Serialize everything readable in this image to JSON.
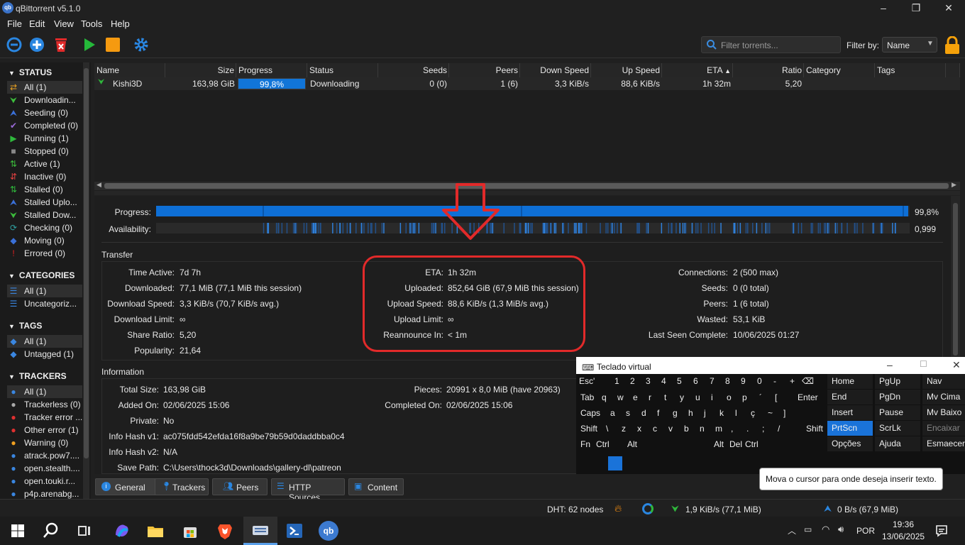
{
  "window": {
    "title": "qBittorrent v5.1.0"
  },
  "menu": [
    "File",
    "Edit",
    "View",
    "Tools",
    "Help"
  ],
  "toolbar": {
    "filter_placeholder": "Filter torrents...",
    "filter_by_label": "Filter by:",
    "filter_by_value": "Name",
    "icons": [
      "link-icon",
      "add-icon",
      "delete-icon",
      "start-icon",
      "stop-icon",
      "options-gear-icon"
    ]
  },
  "sidebar": {
    "status_header": "STATUS",
    "status": [
      "All (1)",
      "Downloadin...",
      "Seeding (0)",
      "Completed (0)",
      "Running (1)",
      "Stopped (0)",
      "Active (1)",
      "Inactive (0)",
      "Stalled (0)",
      "Stalled Uplo...",
      "Stalled Dow...",
      "Checking (0)",
      "Moving (0)",
      "Errored (0)"
    ],
    "categories_header": "CATEGORIES",
    "categories": [
      "All (1)",
      "Uncategoriz..."
    ],
    "tags_header": "TAGS",
    "tags": [
      "All (1)",
      "Untagged (1)"
    ],
    "trackers_header": "TRACKERS",
    "trackers": [
      "All (1)",
      "Trackerless (0)",
      "Tracker error ...",
      "Other error (1)",
      "Warning (0)",
      "atrack.pow7....",
      "open.stealth....",
      "open.touki.r...",
      "p4p.arenabg..."
    ],
    "colors": {
      "status_icons": [
        "#e8a020",
        "#3cbc3c",
        "#3a70d8",
        "#9a6ad8",
        "#2fb83c",
        "#888888",
        "#3cbc3c",
        "#e04040",
        "#2fb83c",
        "#3a70d8",
        "#3cbc3c",
        "#2fa0a0",
        "#3a70d8",
        "#e02020"
      ]
    }
  },
  "torrent_list": {
    "headers": [
      "Name",
      "Size",
      "Progress",
      "Status",
      "Seeds",
      "Peers",
      "Down Speed",
      "Up Speed",
      "ETA",
      "Ratio",
      "Category",
      "Tags"
    ],
    "rows": [
      {
        "name": "Kishi3D",
        "size": "163,98 GiB",
        "progress_text": "99,8%",
        "progress": 0.998,
        "status": "Downloading",
        "seeds": "0 (0)",
        "peers": "1 (6)",
        "down": "3,3 KiB/s",
        "up": "88,6 KiB/s",
        "eta": "1h 32m",
        "ratio": "5,20",
        "category": "",
        "tags": ""
      }
    ]
  },
  "general": {
    "progress_label": "Progress:",
    "progress_value": "99,8%",
    "availability_label": "Availability:",
    "availability_value": "0,999",
    "transfer_header": "Transfer",
    "transfer_col1": [
      [
        "Time Active:",
        "7d 7h"
      ],
      [
        "Downloaded:",
        "77,1 MiB (77,1 MiB this session)"
      ],
      [
        "Download Speed:",
        "3,3 KiB/s (70,7 KiB/s avg.)"
      ],
      [
        "Download Limit:",
        "∞"
      ],
      [
        "Share Ratio:",
        "5,20"
      ],
      [
        "Popularity:",
        "21,64"
      ]
    ],
    "transfer_col2": [
      [
        "ETA:",
        "1h 32m"
      ],
      [
        "Uploaded:",
        "852,64 GiB (67,9 MiB this session)"
      ],
      [
        "Upload Speed:",
        "88,6 KiB/s (1,3 MiB/s avg.)"
      ],
      [
        "Upload Limit:",
        "∞"
      ],
      [
        "Reannounce In:",
        "< 1m"
      ]
    ],
    "transfer_col3": [
      [
        "Connections:",
        "2 (500 max)"
      ],
      [
        "Seeds:",
        "0 (0 total)"
      ],
      [
        "Peers:",
        "1 (6 total)"
      ],
      [
        "Wasted:",
        "53,1 KiB"
      ],
      [
        "Last Seen Complete:",
        "10/06/2025 01:27"
      ]
    ],
    "information_header": "Information",
    "info_col1": [
      [
        "Total Size:",
        "163,98 GiB"
      ],
      [
        "Added On:",
        "02/06/2025 15:06"
      ],
      [
        "Private:",
        "No"
      ],
      [
        "Info Hash v1:",
        "ac075fdd542efda16f8a9be79b59d0daddbba0c4"
      ],
      [
        "Info Hash v2:",
        "N/A"
      ],
      [
        "Save Path:",
        "C:\\Users\\thock3d\\Downloads\\gallery-dl\\patreon"
      ]
    ],
    "info_col2": [
      [
        "Pieces:",
        "20991 x 8,0 MiB (have 20963)"
      ],
      [
        "Completed On:",
        "02/06/2025 15:06"
      ]
    ]
  },
  "bottom_tabs": [
    "General",
    "Trackers",
    "Peers",
    "HTTP Sources",
    "Content"
  ],
  "virtual_keyboard": {
    "title": "Teclado virtual",
    "row1": [
      "Esc",
      "'",
      "1",
      "2",
      "3",
      "4",
      "5",
      "6",
      "7",
      "8",
      "9",
      "0",
      "-",
      "+",
      "⌫"
    ],
    "row2": [
      "Tab",
      "q",
      "w",
      "e",
      "r",
      "t",
      "y",
      "u",
      "i",
      "o",
      "p",
      "´",
      "[",
      "Enter"
    ],
    "row3": [
      "Caps",
      "a",
      "s",
      "d",
      "f",
      "g",
      "h",
      "j",
      "k",
      "l",
      "ç",
      "~",
      "]"
    ],
    "row4": [
      "Shift",
      "\\",
      "z",
      "x",
      "c",
      "v",
      "b",
      "n",
      "m",
      ",",
      ".",
      ";",
      "/",
      "Shift"
    ],
    "row5": [
      "Fn",
      "Ctrl",
      "Alt",
      "Alt",
      "Del",
      "Ctrl"
    ],
    "nav1": [
      "Home",
      "End",
      "Insert",
      "PrtScn",
      "Opções"
    ],
    "nav2": [
      "PgUp",
      "PgDn",
      "Pause",
      "ScrLk",
      "Ajuda"
    ],
    "nav3": [
      "Nav",
      "Mv Cima",
      "Mv Baixo",
      "Encaixar",
      "Esmaecer"
    ],
    "tooltip": "Mova o cursor para onde deseja inserir texto."
  },
  "statusbar": {
    "dht": "DHT: 62 nodes",
    "down": "1,9 KiB/s (77,1 MiB)",
    "up": "0 B/s (67,9 MiB)"
  },
  "taskbar": {
    "language": "POR",
    "time": "19:36",
    "date": "13/06/2025"
  }
}
